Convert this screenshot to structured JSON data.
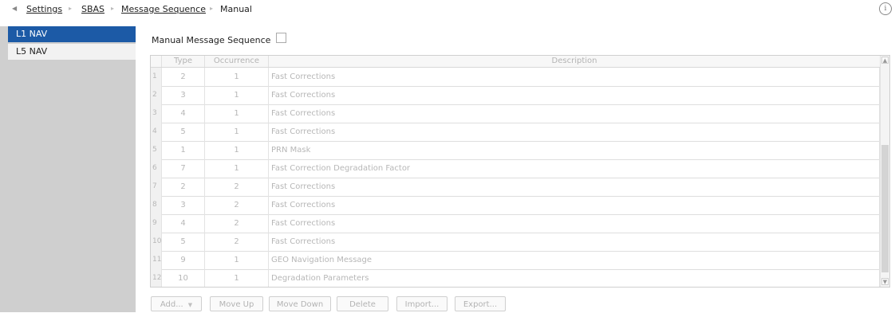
{
  "breadcrumb": {
    "back_icon": "left-triangle-icon",
    "items": [
      "Settings",
      "SBAS",
      "Message Sequence",
      "Manual"
    ]
  },
  "info_icon": "info-icon",
  "sidebar": {
    "items": [
      {
        "label": "L1 NAV",
        "active": true
      },
      {
        "label": "L5 NAV",
        "active": false
      }
    ]
  },
  "main": {
    "manual_sequence_label": "Manual Message Sequence",
    "manual_sequence_checked": false,
    "table": {
      "columns": [
        "Type",
        "Occurrence",
        "Description"
      ],
      "rows": [
        {
          "num": "1",
          "type": "2",
          "occurrence": "1",
          "description": "Fast Corrections"
        },
        {
          "num": "2",
          "type": "3",
          "occurrence": "1",
          "description": "Fast Corrections"
        },
        {
          "num": "3",
          "type": "4",
          "occurrence": "1",
          "description": "Fast Corrections"
        },
        {
          "num": "4",
          "type": "5",
          "occurrence": "1",
          "description": "Fast Corrections"
        },
        {
          "num": "5",
          "type": "1",
          "occurrence": "1",
          "description": "PRN Mask"
        },
        {
          "num": "6",
          "type": "7",
          "occurrence": "1",
          "description": "Fast Correction Degradation Factor"
        },
        {
          "num": "7",
          "type": "2",
          "occurrence": "2",
          "description": "Fast Corrections"
        },
        {
          "num": "8",
          "type": "3",
          "occurrence": "2",
          "description": "Fast Corrections"
        },
        {
          "num": "9",
          "type": "4",
          "occurrence": "2",
          "description": "Fast Corrections"
        },
        {
          "num": "10",
          "type": "5",
          "occurrence": "2",
          "description": "Fast Corrections"
        },
        {
          "num": "11",
          "type": "9",
          "occurrence": "1",
          "description": "GEO Navigation Message"
        },
        {
          "num": "12",
          "type": "10",
          "occurrence": "1",
          "description": "Degradation Parameters"
        }
      ]
    },
    "buttons": {
      "add": "Add...",
      "move_up": "Move Up",
      "move_down": "Move Down",
      "delete": "Delete",
      "import": "Import...",
      "export": "Export..."
    }
  },
  "colors": {
    "accent": "#1c5aa6",
    "sidebar_bg": "#cfcfcf",
    "disabled_text": "#b7b7b7"
  }
}
